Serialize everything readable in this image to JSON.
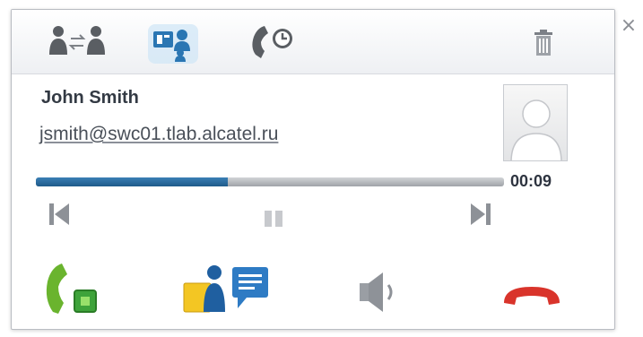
{
  "toolbar": {
    "transfer_icon": "transfer-users-icon",
    "conference_icon": "contact-card-icon",
    "history_icon": "call-history-icon",
    "delete_icon": "trash-icon"
  },
  "contact": {
    "name": "John Smith",
    "email": "jsmith@swc01.tlab.alcatel.ru"
  },
  "playback": {
    "progress_fraction": 0.41,
    "elapsed": "00:09"
  },
  "close_glyph": "×",
  "colors": {
    "accent_blue": "#2a6fa8",
    "answer_green": "#4caf2a",
    "hangup_red": "#d9342b"
  }
}
